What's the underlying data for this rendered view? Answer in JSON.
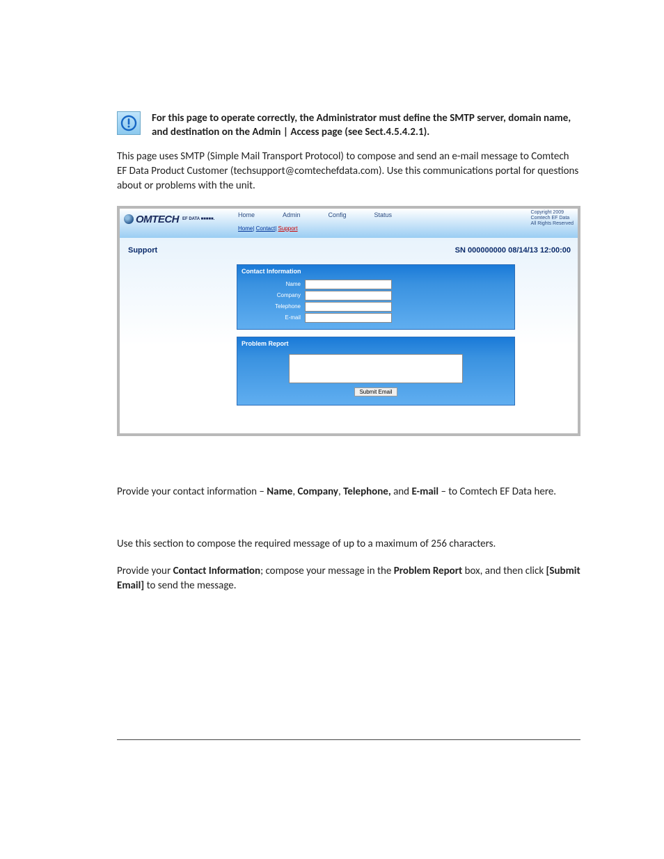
{
  "notice": {
    "text": "For this page to operate correctly, the Administrator must define the SMTP server, domain name, and destination on the Admin | Access page (see Sect.4.5.4.2.1)."
  },
  "intro_para": "This page uses SMTP (Simple Mail Transport Protocol) to compose and send an e-mail message to Comtech EF Data Product Customer (techsupport@comtechefdata.com). Use this communications portal for questions about or problems with the unit.",
  "screenshot": {
    "logo": {
      "text_main": "OMTECH",
      "text_sub": "EF DATA ■■■■■."
    },
    "nav": {
      "home": "Home",
      "admin": "Admin",
      "config": "Config",
      "status": "Status"
    },
    "breadcrumb": {
      "home": "Home",
      "contact": "Contact",
      "support": "Support",
      "sep": "| "
    },
    "copyright": {
      "l1": "Copyright 2009",
      "l2": "Comtech EF Data",
      "l3": "All Rights Reserved"
    },
    "page_title": "Support",
    "status_text": "SN 000000000 08/14/13 12:00:00",
    "contact_panel": {
      "title": "Contact Information",
      "fields": {
        "name": "Name",
        "company": "Company",
        "telephone": "Telephone",
        "email": "E-mail"
      },
      "values": {
        "name": "",
        "company": "",
        "telephone": "",
        "email": ""
      }
    },
    "report_panel": {
      "title": "Problem Report",
      "value": "",
      "submit": "Submit Email"
    }
  },
  "below": {
    "p1_a": "Provide your contact information – ",
    "p1_b1": "Name",
    "p1_c1": ", ",
    "p1_b2": "Company",
    "p1_c2": ", ",
    "p1_b3": "Telephone,",
    "p1_c3": " and ",
    "p1_b4": "E-mail",
    "p1_d": " – to Comtech EF Data here.",
    "p2": "Use this section to compose the required message of up to a maximum of 256 characters.",
    "p3_a": "Provide your ",
    "p3_b1": "Contact Information",
    "p3_c": "; compose your message in the ",
    "p3_b2": "Problem Report",
    "p3_d": " box, and then click ",
    "p3_b3": "[Submit Email]",
    "p3_e": " to send the message."
  }
}
